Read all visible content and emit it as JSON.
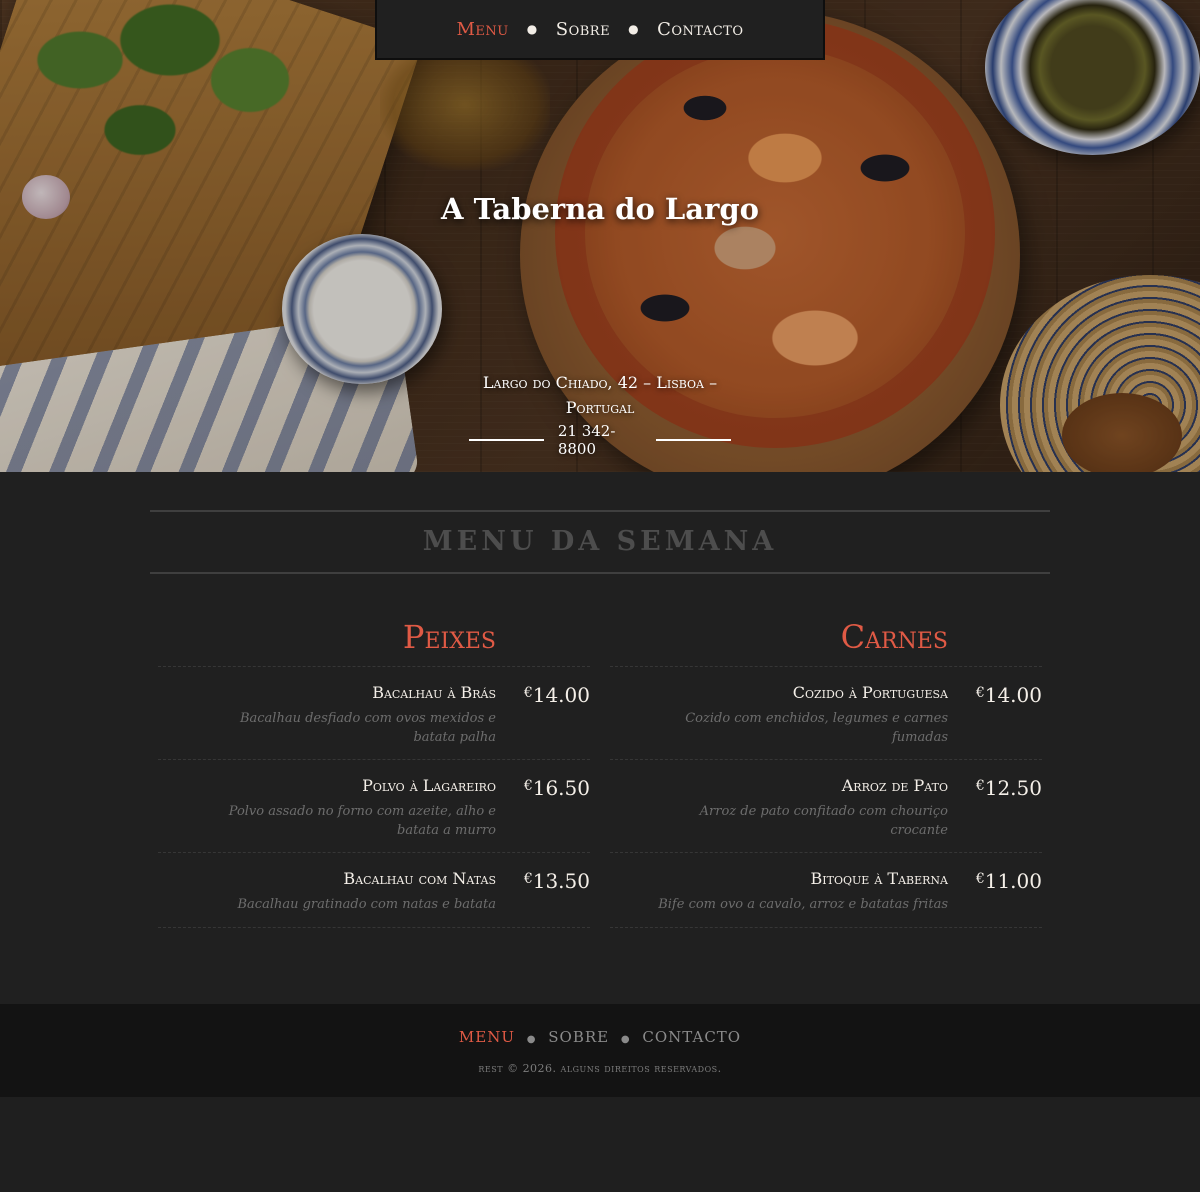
{
  "nav": {
    "items": [
      {
        "label": "Menu",
        "active": true
      },
      {
        "label": "Sobre",
        "active": false
      },
      {
        "label": "Contacto",
        "active": false
      }
    ]
  },
  "hero": {
    "title": "A Taberna do Largo",
    "address_line1": "Largo do Chiado, 42 – Lisboa –",
    "address_line2": "Portugal",
    "phone": "21 342-8800"
  },
  "menu": {
    "heading": "MENU DA SEMANA",
    "categories": [
      {
        "title": "Peixes",
        "items": [
          {
            "name": "Bacalhau à Brás",
            "description": "Bacalhau desfiado com ovos mexidos e batata palha",
            "currency": "€",
            "price": "14.00"
          },
          {
            "name": "Polvo à Lagareiro",
            "description": "Polvo assado no forno com azeite, alho e batata a murro",
            "currency": "€",
            "price": "16.50"
          },
          {
            "name": "Bacalhau com Natas",
            "description": "Bacalhau gratinado com natas e batata",
            "currency": "€",
            "price": "13.50"
          }
        ]
      },
      {
        "title": "Carnes",
        "items": [
          {
            "name": "Cozido à Portuguesa",
            "description": "Cozido com enchidos, legumes e carnes fumadas",
            "currency": "€",
            "price": "14.00"
          },
          {
            "name": "Arroz de Pato",
            "description": "Arroz de pato confitado com chouriço crocante",
            "currency": "€",
            "price": "12.50"
          },
          {
            "name": "Bitoque à Taberna",
            "description": "Bife com ovo a cavalo, arroz e batatas fritas",
            "currency": "€",
            "price": "11.00"
          }
        ]
      }
    ]
  },
  "footer": {
    "nav": [
      {
        "label": "Menu",
        "active": true
      },
      {
        "label": "Sobre",
        "active": false
      },
      {
        "label": "Contacto",
        "active": false
      }
    ],
    "copyright": "rest © 2026. alguns direitos reservados."
  },
  "colors": {
    "accent": "#e05a45",
    "background": "#202020",
    "footer_background": "#131313"
  }
}
